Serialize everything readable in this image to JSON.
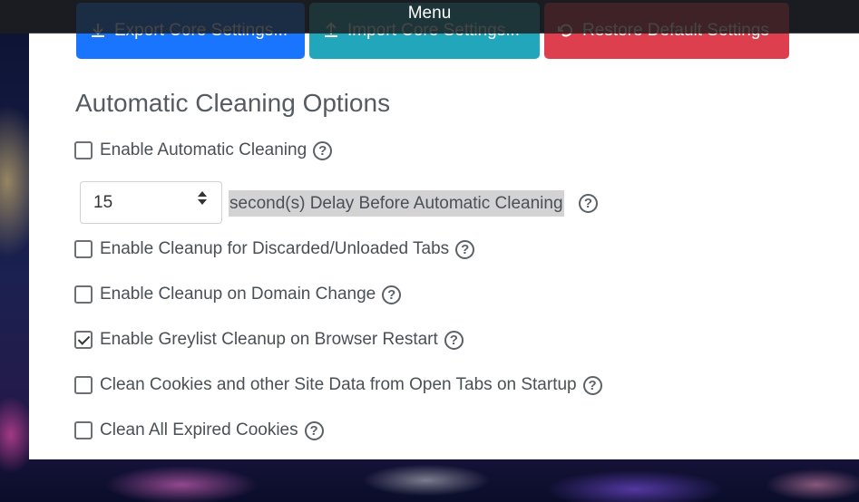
{
  "topbar": {
    "title": "Menu"
  },
  "toolbar": {
    "export_label": "Export Core Settings...",
    "import_label": "Import Core Settings...",
    "restore_label": "Restore Default Settings"
  },
  "section": {
    "title": "Automatic Cleaning Options"
  },
  "delay": {
    "value": "15",
    "label": "second(s) Delay Before Automatic Cleaning"
  },
  "options": [
    {
      "label": "Enable Automatic Cleaning",
      "checked": false
    },
    {
      "label": "Enable Cleanup for Discarded/Unloaded Tabs",
      "checked": false
    },
    {
      "label": "Enable Cleanup on Domain Change",
      "checked": false
    },
    {
      "label": "Enable Greylist Cleanup on Browser Restart",
      "checked": true
    },
    {
      "label": "Clean Cookies and other Site Data from Open Tabs on Startup",
      "checked": false
    },
    {
      "label": "Clean All Expired Cookies",
      "checked": false
    }
  ],
  "help_glyph": "?",
  "colors": {
    "export": "#0d6efd",
    "import": "#17a2b8",
    "restore": "#dc3545"
  }
}
